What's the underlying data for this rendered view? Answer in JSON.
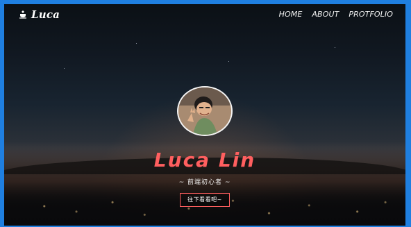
{
  "brand": {
    "name": "Luca"
  },
  "nav": {
    "items": [
      "HOME",
      "ABOUT",
      "PROTFOLIO"
    ]
  },
  "hero": {
    "name": "Luca Lin",
    "tagline": "~ 前端初心者 ~",
    "cta": "往下看看吧~"
  }
}
